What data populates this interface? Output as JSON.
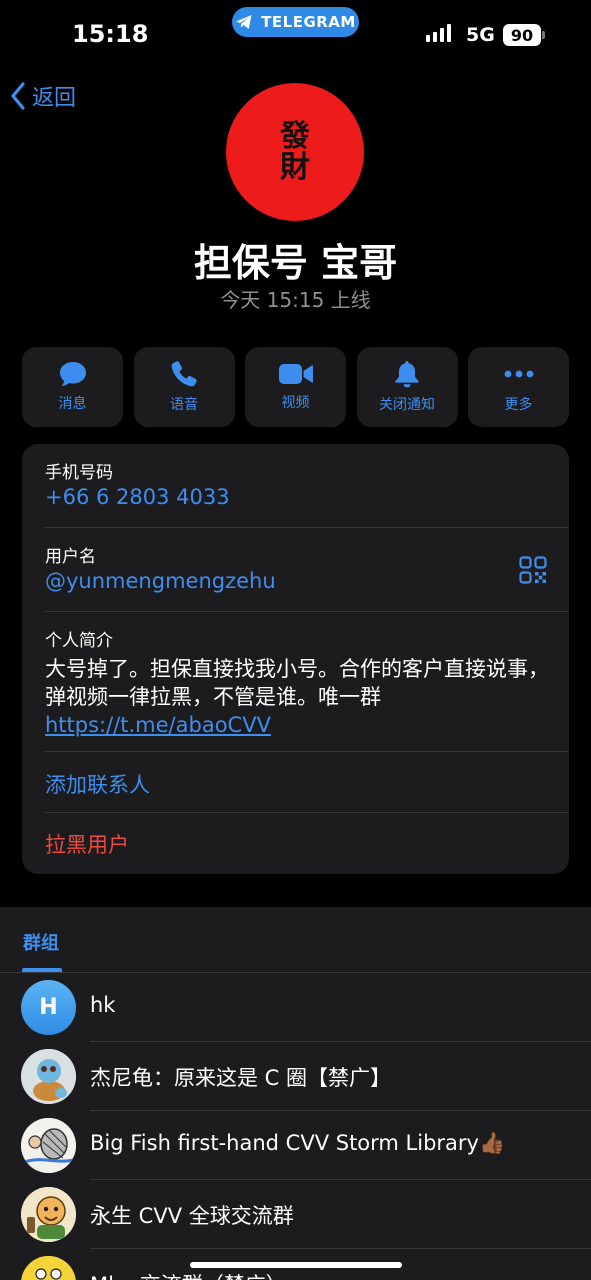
{
  "status_bar": {
    "time": "15:18",
    "app_pill": "TELEGRAM",
    "network": "5G",
    "battery": "90"
  },
  "nav": {
    "back_label": "返回"
  },
  "profile": {
    "avatar_text": "發財",
    "name": "担保号 宝哥",
    "last_seen": "今天 15:15 上线"
  },
  "actions": [
    {
      "label": "消息",
      "icon": "message-icon"
    },
    {
      "label": "语音",
      "icon": "phone-icon"
    },
    {
      "label": "视频",
      "icon": "video-icon"
    },
    {
      "label": "关闭通知",
      "icon": "bell-icon"
    },
    {
      "label": "更多",
      "icon": "more-icon"
    }
  ],
  "info": {
    "phone_label": "手机号码",
    "phone_value": "+66 6 2803 4033",
    "username_label": "用户名",
    "username_value": "@yunmengmengzehu",
    "bio_label": "个人简介",
    "bio_text": "大号掉了。担保直接找我小号。合作的客户直接说事，弹视频一律拉黑，不管是谁。唯一群",
    "bio_link": "https://t.me/abaoCVV",
    "add_contact": "添加联系人",
    "block_user": "拉黑用户"
  },
  "groups": {
    "tab_label": "群组",
    "items": [
      {
        "name": "hk",
        "avatar_letter": "H"
      },
      {
        "name": "杰尼龟：原来这是 C 圈【禁广】"
      },
      {
        "name": "Big Fish first-hand CVV Storm Library👍🏾"
      },
      {
        "name": "永生 CVV 全球交流群"
      },
      {
        "name": "Mlo..交流群（禁广）"
      }
    ]
  },
  "colors": {
    "accent": "#3e8ef0",
    "danger": "#f04a3e",
    "card_bg": "#1c1c1e",
    "avatar_red": "#ee1b1b"
  }
}
